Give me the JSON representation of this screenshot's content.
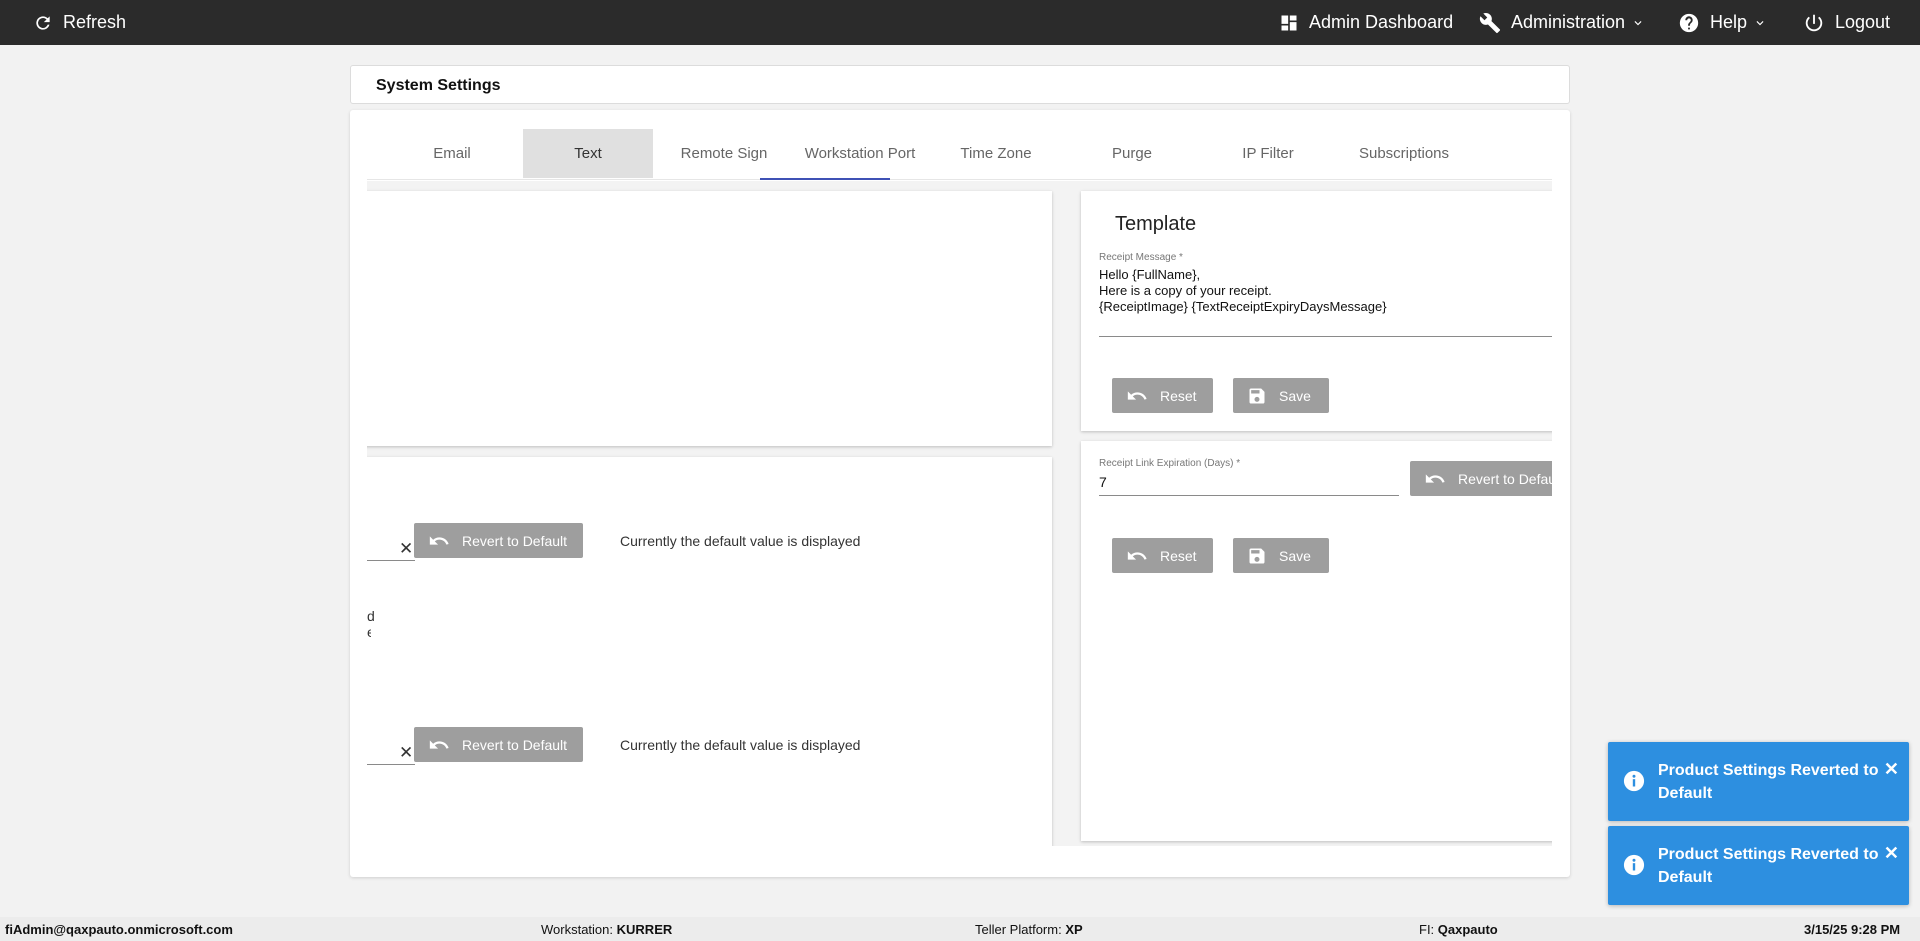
{
  "topbar": {
    "refresh": "Refresh",
    "admin_dashboard": "Admin Dashboard",
    "administration": "Administration",
    "help": "Help",
    "logout": "Logout"
  },
  "page": {
    "title": "System Settings"
  },
  "tabs": [
    "Email",
    "Text",
    "Remote Sign",
    "Workstation Port",
    "Time Zone",
    "Purge",
    "IP Filter",
    "Subscriptions"
  ],
  "active_tab": "Text",
  "left_panel": {
    "fragment_line1": "d",
    "fragment_line2": "e",
    "revert_label": "Revert to Default",
    "default_note": "Currently the default value is displayed"
  },
  "template": {
    "heading": "Template",
    "receipt_message_label": "Receipt Message *",
    "receipt_message_lines": [
      "Hello {FullName},",
      "Here is a copy of your receipt.",
      "{ReceiptImage} {TextReceiptExpiryDaysMessage}"
    ],
    "reset_label": "Reset",
    "save_label": "Save"
  },
  "expiration": {
    "label": "Receipt Link Expiration (Days) *",
    "value": "7",
    "revert_label": "Revert to Default",
    "reset_label": "Reset",
    "save_label": "Save"
  },
  "toasts": [
    {
      "message": "Product Settings Reverted to Default"
    },
    {
      "message": "Product Settings Reverted to Default"
    }
  ],
  "statusbar": {
    "user": "fiAdmin@qaxpauto.onmicrosoft.com",
    "workstation_label": "Workstation:",
    "workstation_value": "KURRER",
    "platform_label": "Teller Platform:",
    "platform_value": "XP",
    "fi_label": "FI:",
    "fi_value": "Qaxpauto",
    "datetime": "3/15/25 9:28 PM"
  },
  "colors": {
    "topbar": "#2b2b2b",
    "tab_indicator": "#3f51b5",
    "button": "#9e9e9e",
    "toast": "#2d8fe0"
  }
}
